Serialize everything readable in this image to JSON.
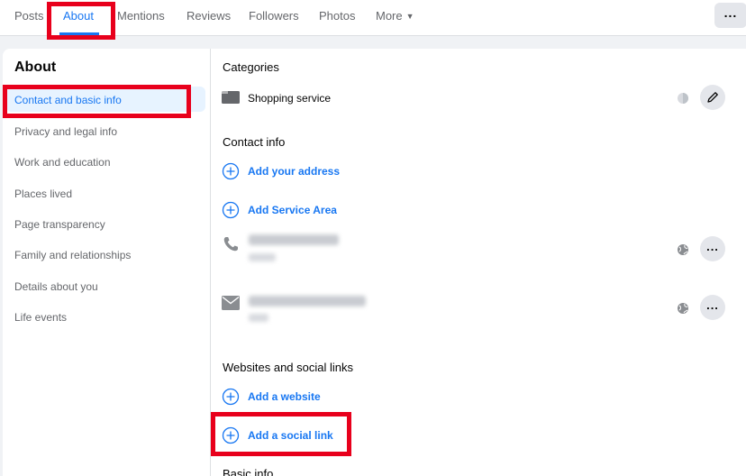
{
  "nav": {
    "tabs": [
      {
        "label": "Posts"
      },
      {
        "label": "About"
      },
      {
        "label": "Mentions"
      },
      {
        "label": "Reviews"
      },
      {
        "label": "Followers"
      },
      {
        "label": "Photos"
      },
      {
        "label": "More"
      }
    ],
    "active_tab": "About",
    "more_caret": "▼",
    "menu_dots": "..."
  },
  "sidebar": {
    "title": "About",
    "items": [
      {
        "label": "Contact and basic info",
        "selected": true
      },
      {
        "label": "Privacy and legal info"
      },
      {
        "label": "Work and education"
      },
      {
        "label": "Places lived"
      },
      {
        "label": "Page transparency"
      },
      {
        "label": "Family and relationships"
      },
      {
        "label": "Details about you"
      },
      {
        "label": "Life events"
      }
    ]
  },
  "main": {
    "categories": {
      "title": "Categories",
      "value": "Shopping service",
      "icon": "category-icon"
    },
    "contact_info": {
      "title": "Contact info",
      "add_address": "Add your address",
      "add_service_area": "Add Service Area",
      "phone_icon": "phone-icon",
      "email_icon": "envelope-icon"
    },
    "websites": {
      "title": "Websites and social links",
      "add_website": "Add a website",
      "add_social_link": "Add a social link"
    },
    "basic_info": {
      "title": "Basic info"
    },
    "row_menu_dots": "..."
  },
  "colors": {
    "accent": "#1877f2",
    "highlight": "#e8001c",
    "background": "#f0f2f5"
  }
}
